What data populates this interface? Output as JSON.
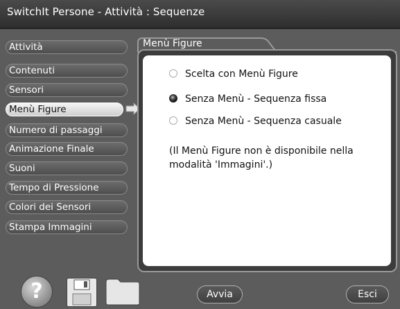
{
  "window": {
    "title": "SwitchIt Persone - Attività : Sequenze"
  },
  "sidebar": {
    "items": [
      {
        "label": "Attività",
        "active": false
      },
      {
        "label": "Contenuti",
        "active": false
      },
      {
        "label": "Sensori",
        "active": false
      },
      {
        "label": "Menù Figure",
        "active": true
      },
      {
        "label": "Numero di passaggi",
        "active": false
      },
      {
        "label": "Animazione Finale",
        "active": false
      },
      {
        "label": "Suoni",
        "active": false
      },
      {
        "label": "Tempo di Pressione",
        "active": false
      },
      {
        "label": "Colori dei Sensori",
        "active": false
      },
      {
        "label": "Stampa Immagini",
        "active": false
      }
    ]
  },
  "panel": {
    "title": "Menù Figure",
    "options": [
      {
        "label": "Scelta con Menù Figure",
        "selected": false
      },
      {
        "label": "Senza Menù - Sequenza fissa",
        "selected": true
      },
      {
        "label": "Senza Menù - Sequenza casuale",
        "selected": false
      }
    ],
    "note": "(Il Menù Figure non è disponibile nella modalità 'Immagini'.)"
  },
  "bottom": {
    "help_icon": "?",
    "start_label": "Avvia",
    "exit_label": "Esci"
  }
}
